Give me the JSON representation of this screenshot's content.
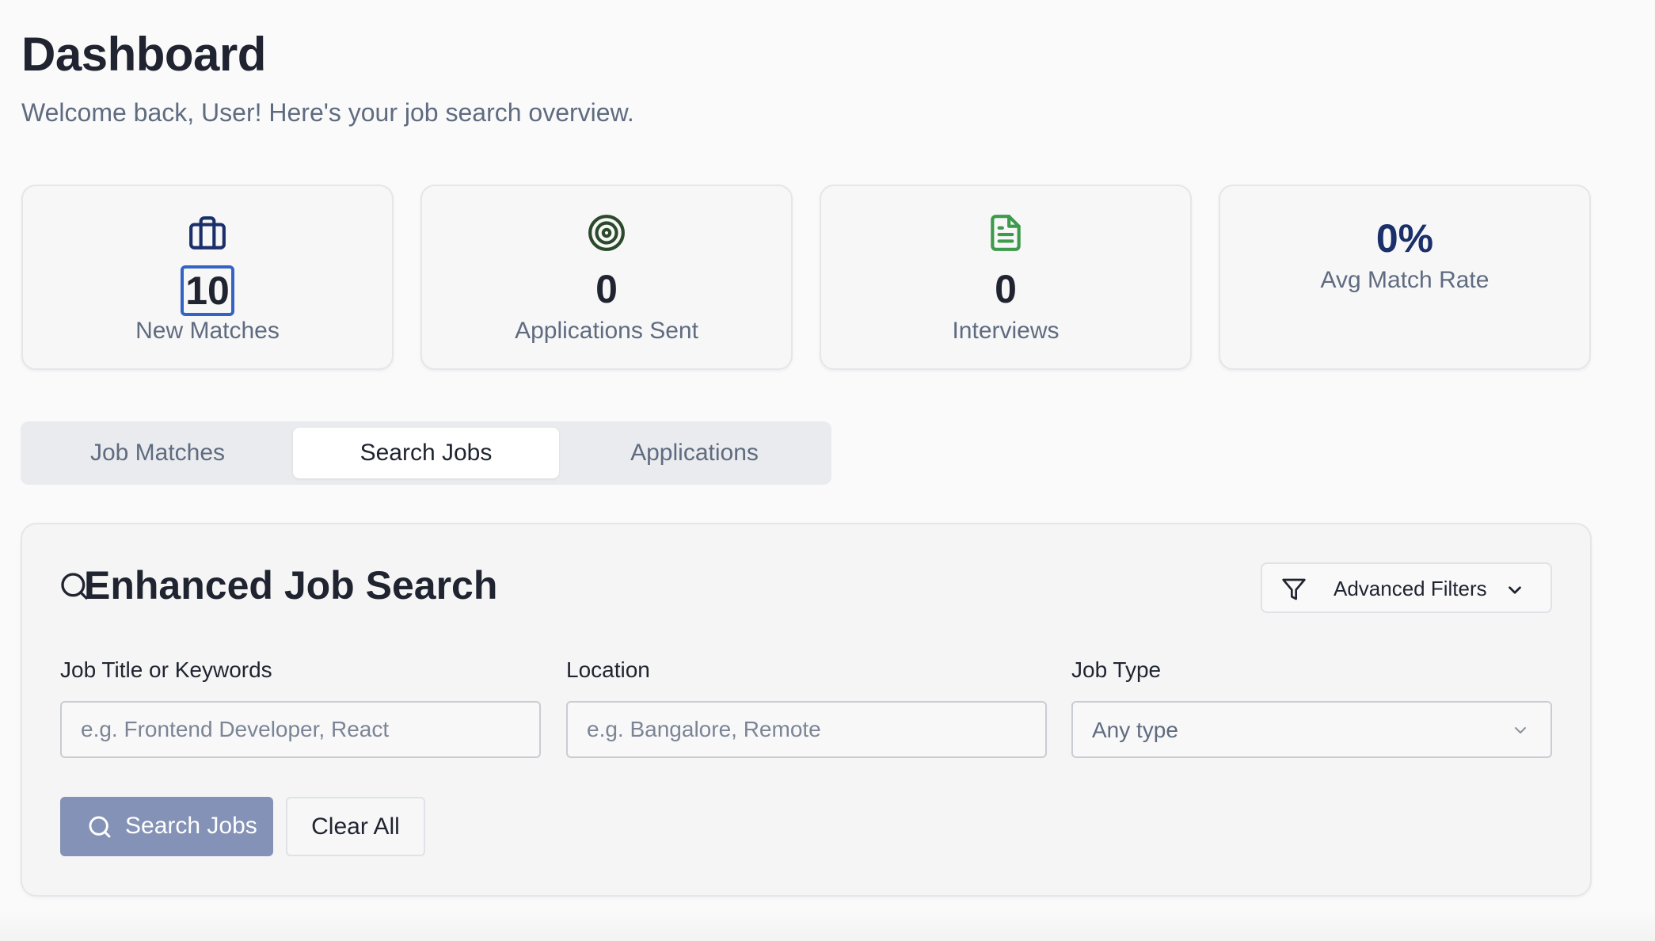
{
  "header": {
    "title": "Dashboard",
    "subtitle": "Welcome back, User! Here's your job search overview."
  },
  "stats": [
    {
      "icon": "briefcase-icon",
      "value": "10",
      "label": "New Matches",
      "icon_color": "#1b2f6b"
    },
    {
      "icon": "target-icon",
      "value": "0",
      "label": "Applications Sent",
      "icon_color": "#2b4a2b"
    },
    {
      "icon": "document-icon",
      "value": "0",
      "label": "Interviews",
      "icon_color": "#3e9a4c"
    },
    {
      "icon": null,
      "value": "0%",
      "label": "Avg Match Rate"
    }
  ],
  "tabs": [
    {
      "label": "Job Matches",
      "active": false
    },
    {
      "label": "Search Jobs",
      "active": true
    },
    {
      "label": "Applications",
      "active": false
    }
  ],
  "search": {
    "title": "Enhanced Job Search",
    "advanced_filters_label": "Advanced Filters",
    "keywords": {
      "label": "Job Title or Keywords",
      "placeholder": "e.g. Frontend Developer, React",
      "value": ""
    },
    "location": {
      "label": "Location",
      "placeholder": "e.g. Bangalore, Remote",
      "value": ""
    },
    "job_type": {
      "label": "Job Type",
      "value": "Any type"
    },
    "search_button_label": "Search Jobs",
    "clear_button_label": "Clear All"
  },
  "colors": {
    "primary_button": "#8392b6",
    "focus_outline": "#3563c4"
  }
}
